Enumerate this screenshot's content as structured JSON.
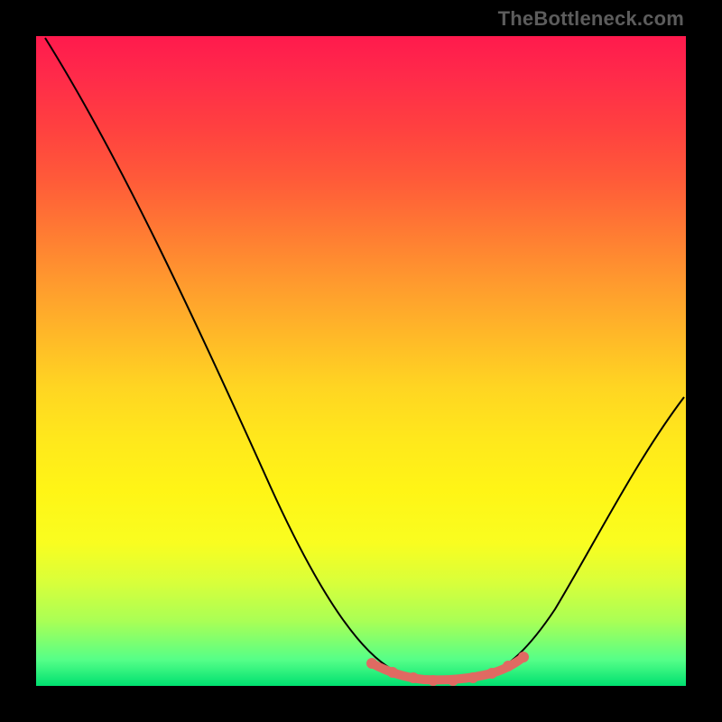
{
  "watermark": "TheBottleneck.com",
  "chart_data": {
    "type": "line",
    "title": "",
    "xlabel": "",
    "ylabel": "",
    "xlim": [
      0,
      100
    ],
    "ylim": [
      0,
      100
    ],
    "grid": false,
    "series": [
      {
        "name": "curve",
        "x": [
          0,
          10,
          20,
          30,
          40,
          48,
          52,
          56,
          60,
          65,
          70,
          76,
          84,
          92,
          100
        ],
        "y": [
          100,
          80,
          62,
          46,
          30,
          16,
          8,
          3,
          1,
          0.5,
          1,
          4,
          12,
          26,
          44
        ]
      }
    ],
    "markers": {
      "x": [
        54,
        56,
        58,
        60,
        62,
        64,
        66,
        68,
        70,
        72,
        74
      ],
      "y": [
        3,
        2,
        1.2,
        1,
        0.8,
        0.8,
        0.8,
        1,
        1.5,
        2.5,
        4
      ]
    },
    "colors": {
      "curve": "#000000",
      "marker": "#e06a62",
      "gradient_top": "#ff1a4d",
      "gradient_bottom": "#00e070"
    }
  }
}
